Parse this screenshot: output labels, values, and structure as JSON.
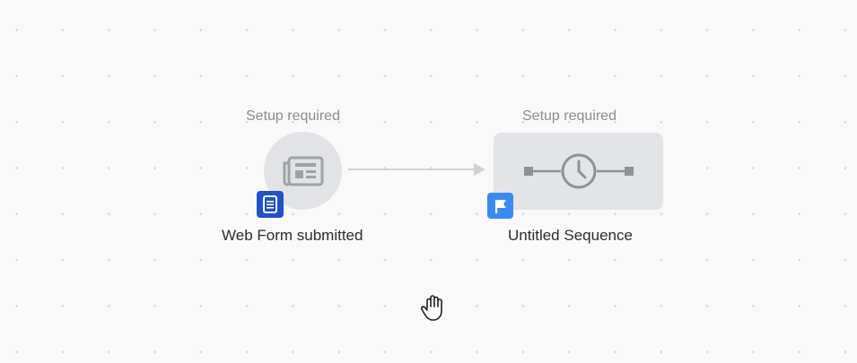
{
  "workflow": {
    "trigger": {
      "status": "Setup required",
      "title": "Web Form submitted",
      "icon": "newspaper-icon",
      "badge_icon": "form-icon",
      "badge_color": "#2151c7"
    },
    "action": {
      "status": "Setup required",
      "title": "Untitled Sequence",
      "icon": "timeline-clock-icon",
      "badge_icon": "flag-icon",
      "badge_color": "#3a8bf0"
    }
  },
  "colors": {
    "canvas_bg": "#f9f9fa",
    "node_bg": "#e2e3e6",
    "connector": "#d0d2d6"
  }
}
